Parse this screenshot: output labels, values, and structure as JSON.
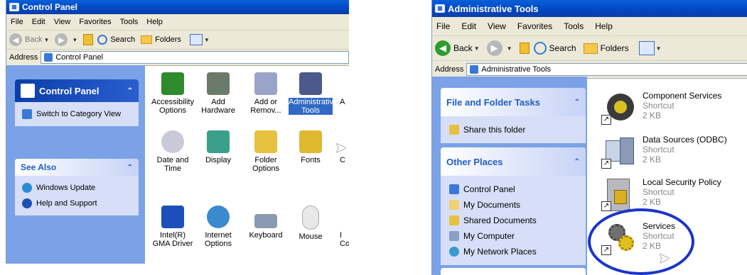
{
  "left_window": {
    "title": "Control Panel",
    "menu": [
      "File",
      "Edit",
      "View",
      "Favorites",
      "Tools",
      "Help"
    ],
    "toolbar": {
      "back": "Back",
      "search": "Search",
      "folders": "Folders"
    },
    "address_label": "Address",
    "address_value": "Control Panel",
    "task_pane": {
      "header": "Control Panel",
      "switch_link": "Switch to Category View",
      "see_also_header": "See Also",
      "see_also": [
        "Windows Update",
        "Help and Support"
      ]
    },
    "items": [
      {
        "label": "Accessibility Options",
        "icon": "accessibility-icon",
        "color": "#2e8b2e"
      },
      {
        "label": "Add Hardware",
        "icon": "add-hardware-icon",
        "color": "#6b7b6b"
      },
      {
        "label": "Add or Remov...",
        "icon": "add-remove-icon",
        "color": "#9aa4c8"
      },
      {
        "label": "Administrative Tools",
        "icon": "admin-tools-icon",
        "color": "#4a5a8a"
      },
      {
        "label": "A",
        "icon": "partial-icon",
        "color": "#999999"
      },
      {
        "label": "Date and Time",
        "icon": "clock-icon",
        "color": "#c9c9d9"
      },
      {
        "label": "Display",
        "icon": "display-icon",
        "color": "#3aa08a"
      },
      {
        "label": "Folder Options",
        "icon": "folder-options-icon",
        "color": "#e8c040"
      },
      {
        "label": "Fonts",
        "icon": "fonts-icon",
        "color": "#e0b830"
      },
      {
        "label": "C",
        "icon": "partial-icon",
        "color": "#999999"
      },
      {
        "label": "Intel(R) GMA Driver",
        "icon": "intel-gma-icon",
        "color": "#1d4fb8"
      },
      {
        "label": "Internet Options",
        "icon": "globe-icon",
        "color": "#3a8ad0"
      },
      {
        "label": "Keyboard",
        "icon": "keyboard-icon",
        "color": "#8a9ab0"
      },
      {
        "label": "Mouse",
        "icon": "mouse-icon",
        "color": "#d8d8d8"
      },
      {
        "label": "I Co",
        "icon": "partial-icon",
        "color": "#999999"
      }
    ]
  },
  "right_window": {
    "title": "Administrative Tools",
    "menu": [
      "File",
      "Edit",
      "View",
      "Favorites",
      "Tools",
      "Help"
    ],
    "toolbar": {
      "back": "Back",
      "search": "Search",
      "folders": "Folders"
    },
    "address_label": "Address",
    "address_value": "Administrative Tools",
    "file_tasks": {
      "header": "File and Folder Tasks",
      "items": [
        "Share this folder"
      ]
    },
    "other_places": {
      "header": "Other Places",
      "items": [
        "Control Panel",
        "My Documents",
        "Shared Documents",
        "My Computer",
        "My Network Places"
      ]
    },
    "tiles": [
      {
        "name": "Component Services",
        "type": "Shortcut",
        "size": "2 KB",
        "icon": "component-services-icon"
      },
      {
        "name": "Data Sources (ODBC)",
        "type": "Shortcut",
        "size": "2 KB",
        "icon": "odbc-icon"
      },
      {
        "name": "Local Security Policy",
        "type": "Shortcut",
        "size": "2 KB",
        "icon": "security-policy-icon"
      },
      {
        "name": "Services",
        "type": "Shortcut",
        "size": "2 KB",
        "icon": "services-gear-icon"
      }
    ]
  },
  "colors": {
    "xp_title": "#0a5fd8",
    "task_pane": "#7ba2e7",
    "highlight_ellipse": "#1a35c9",
    "selection": "#316ac5"
  }
}
